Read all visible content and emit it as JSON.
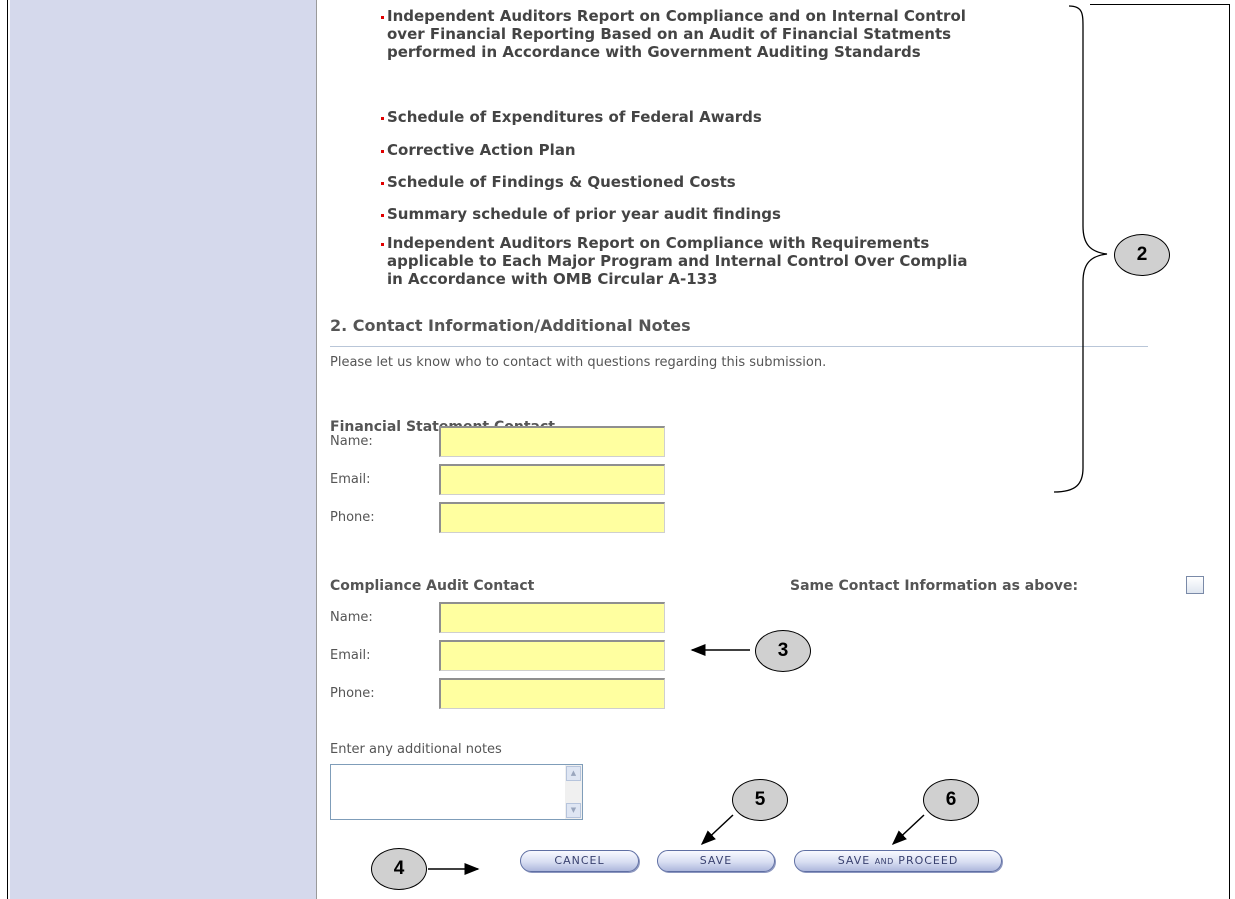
{
  "bullets": [
    [
      "Independent Auditors Report on Compliance and on Internal Control",
      "over Financial Reporting Based on an Audit of Financial Statments",
      "performed in Accordance with Government Auditing Standards"
    ],
    [
      "Schedule of Expenditures of Federal Awards"
    ],
    [
      "Corrective Action Plan"
    ],
    [
      "Schedule of Findings & Questioned Costs"
    ],
    [
      "Summary schedule of prior year audit findings"
    ],
    [
      "Independent Auditors Report on Compliance with Requirements",
      "applicable to Each Major Program and Internal Control Over Complia",
      "in Accordance with OMB Circular A-133"
    ]
  ],
  "section": {
    "title": "2. Contact Information/Additional Notes",
    "description": "Please let us know who to contact with questions regarding this submission."
  },
  "financial_contact": {
    "title": "Financial Statement Contact",
    "name_label": "Name:",
    "email_label": "Email:",
    "phone_label": "Phone:",
    "name_value": "",
    "email_value": "",
    "phone_value": ""
  },
  "compliance_contact": {
    "title": "Compliance Audit Contact",
    "same_as_above_label": "Same Contact Information as above:",
    "same_as_above_checked": false,
    "name_label": "Name:",
    "email_label": "Email:",
    "phone_label": "Phone:",
    "name_value": "",
    "email_value": "",
    "phone_value": ""
  },
  "notes": {
    "label": "Enter any additional notes",
    "value": ""
  },
  "buttons": {
    "cancel": "CANCEL",
    "save": "SAVE",
    "save_proceed_part1": "SAVE ",
    "save_proceed_part2": "AND",
    "save_proceed_part3": " PROCEED"
  },
  "callouts": {
    "c2": "2",
    "c3": "3",
    "c4": "4",
    "c5": "5",
    "c6": "6"
  },
  "colors": {
    "sidebar": "#d5d9ec",
    "input_fill": "#ffffa0",
    "bullet_marker": "#e00000",
    "callout_fill": "#d0d0d0"
  }
}
